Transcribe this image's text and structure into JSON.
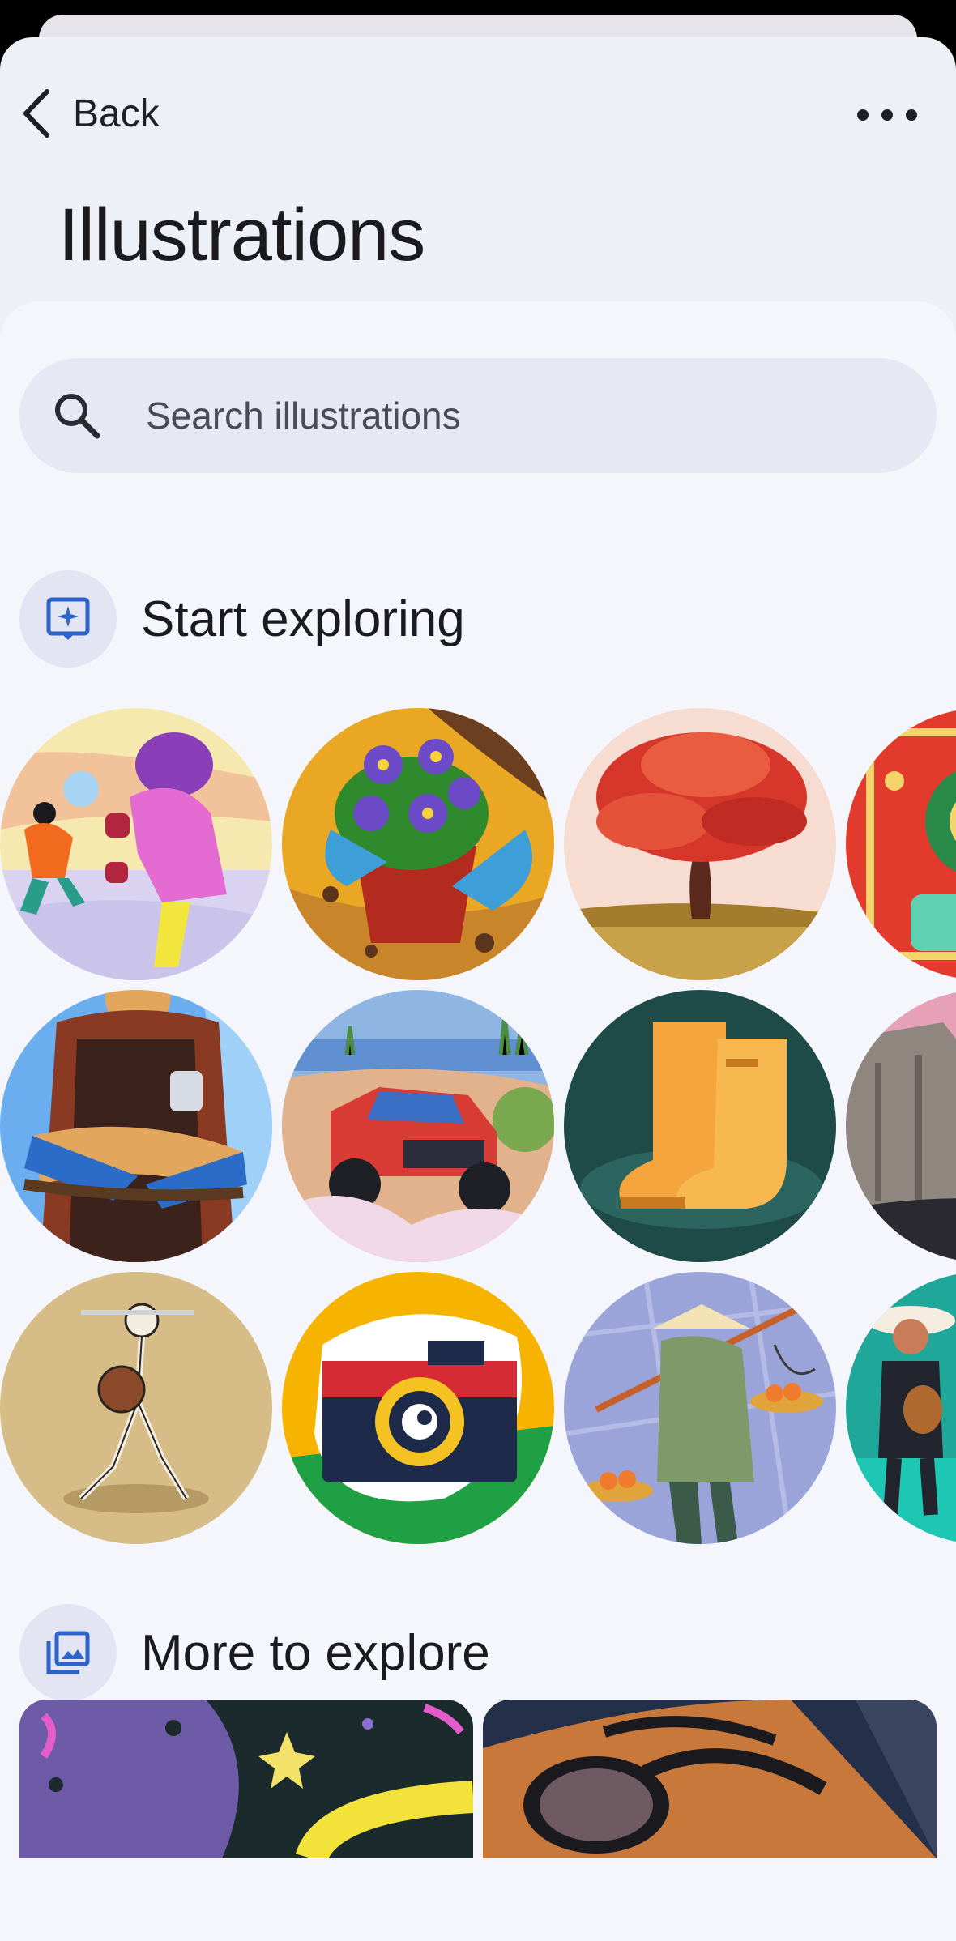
{
  "header": {
    "back_label": "Back",
    "more_icon": "more-horizontal-icon",
    "title": "Illustrations"
  },
  "search": {
    "placeholder": "Search illustrations",
    "icon": "search-icon"
  },
  "sections": {
    "start": {
      "title": "Start exploring",
      "icon": "sparkle-frame-icon"
    },
    "more": {
      "title": "More to explore",
      "icon": "photo-gallery-icon"
    }
  },
  "illustrations": [
    "snowball-fight",
    "potted-violets",
    "red-maple-tree",
    "decorative-pattern",
    "tattoo-artist",
    "offroad-truck",
    "rain-boots",
    "rocky-cliff",
    "skeleton-warrior",
    "retro-camera",
    "fruit-vendor",
    "mariachi-musicians"
  ],
  "colors": {
    "accent": "#2e63c9",
    "sheet_bg": "#eef0f8",
    "content_bg": "#f5f6fc",
    "search_bg": "#e6e8f3"
  }
}
